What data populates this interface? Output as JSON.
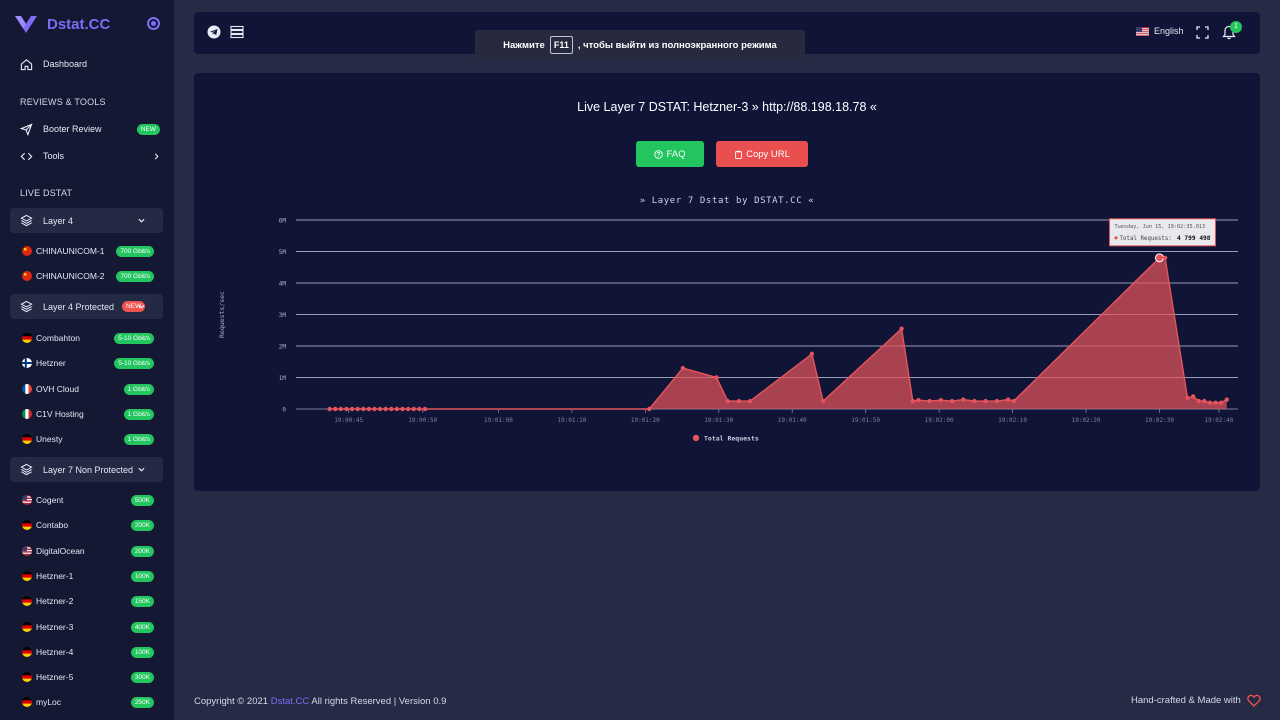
{
  "brand": {
    "name": "Dstat.CC"
  },
  "sidebar": {
    "dashboard": "Dashboard",
    "section_reviews": "REVIEWS & TOOLS",
    "booter_review": "Booter Review",
    "booter_badge": "NEW",
    "tools": "Tools",
    "section_live": "LIVE DSTAT",
    "layer4": {
      "label": "Layer 4",
      "items": [
        {
          "name": "CHINAUNICOM-1",
          "badge": "700 Gbit/s",
          "flag": "cn"
        },
        {
          "name": "CHINAUNICOM-2",
          "badge": "700 Gbit/s",
          "flag": "cn"
        }
      ]
    },
    "layer4p": {
      "label": "Layer 4 Protected",
      "badge": "NEW",
      "items": [
        {
          "name": "Combahton",
          "badge": "5-10 Gbit/s",
          "flag": "de"
        },
        {
          "name": "Hetzner",
          "badge": "5-10 Gbit/s",
          "flag": "fi"
        },
        {
          "name": "OVH Cloud",
          "badge": "1 Gbit/s",
          "flag": "fr"
        },
        {
          "name": "C1V Hosting",
          "badge": "1 Gbit/s",
          "flag": "it"
        },
        {
          "name": "Unesty",
          "badge": "1 Gbit/s",
          "flag": "de"
        }
      ]
    },
    "layer7": {
      "label": "Layer 7 Non Protected",
      "items": [
        {
          "name": "Cogent",
          "badge": "500K",
          "flag": "us"
        },
        {
          "name": "Contabo",
          "badge": "200K",
          "flag": "de"
        },
        {
          "name": "DigitalOcean",
          "badge": "200K",
          "flag": "us"
        },
        {
          "name": "Hetzner-1",
          "badge": "100K",
          "flag": "de"
        },
        {
          "name": "Hetzner-2",
          "badge": "150K",
          "flag": "de"
        },
        {
          "name": "Hetzner-3",
          "badge": "400K",
          "flag": "de"
        },
        {
          "name": "Hetzner-4",
          "badge": "100K",
          "flag": "de"
        },
        {
          "name": "Hetzner-5",
          "badge": "300K",
          "flag": "de"
        },
        {
          "name": "myLoc",
          "badge": "250K",
          "flag": "de"
        }
      ]
    }
  },
  "topbar": {
    "language": "English",
    "notifications": "1",
    "fullscreen_notice_before": "Нажмите",
    "fullscreen_notice_key": "F11",
    "fullscreen_notice_after": ", чтобы выйти из полноэкранного режима"
  },
  "main": {
    "title": "Live Layer 7 DSTAT: Hetzner-3 » http://88.198.18.78 «",
    "faq_button": "FAQ",
    "copy_button": "Copy URL",
    "chart_title": "» Layer 7 Dstat by DSTAT.CC «"
  },
  "chart_data": {
    "type": "area",
    "title": "» Layer 7 Dstat by DSTAT.CC «",
    "ylabel": "Requests/sec",
    "ylim": [
      0,
      6000000
    ],
    "y_ticks": [
      "0",
      "1M",
      "2M",
      "3M",
      "4M",
      "5M",
      "6M"
    ],
    "x_ticks": [
      "19:00:45",
      "19:00:50",
      "19:01:00",
      "19:01:10",
      "19:01:20",
      "19:01:30",
      "19:01:40",
      "19:01:50",
      "19:02:00",
      "19:02:10",
      "19:02:20",
      "19:02:30",
      "19:02:40"
    ],
    "series": [
      {
        "name": "Total Requests",
        "color": "#e5545a",
        "x": [
          40.5,
          41,
          41.5,
          42,
          42.5,
          43,
          43.5,
          44,
          44.5,
          45,
          45.5,
          46,
          46.5,
          47,
          47.5,
          48,
          48.5,
          49,
          69,
          72,
          75,
          76,
          77,
          78,
          83.5,
          84.5,
          91.5,
          92.5,
          93,
          94,
          95,
          96,
          97,
          98,
          99,
          100,
          101,
          101.5,
          114.5,
          115,
          117,
          117.5,
          118,
          118.5,
          119,
          119.5,
          120,
          120.5
        ],
        "values": [
          0,
          0,
          0,
          0,
          0,
          0,
          0,
          0,
          0,
          0,
          0,
          0,
          0,
          0,
          0,
          0,
          0,
          0,
          0,
          1300000,
          1000000,
          250000,
          250000,
          250000,
          1750000,
          250000,
          2550000,
          250000,
          280000,
          250000,
          280000,
          250000,
          300000,
          250000,
          250000,
          250000,
          300000,
          250000,
          4799498,
          4799498,
          350000,
          400000,
          250000,
          250000,
          200000,
          200000,
          200000,
          300000
        ]
      }
    ],
    "tooltip": {
      "date": "Tuesday, Jun 15, 19:02:35.013",
      "label": "Total Requests:",
      "value": "4 799 498"
    },
    "legend": "bottom",
    "grid": true
  },
  "footer": {
    "copyright_prefix": "Copyright © 2021",
    "copyright_link": "Dstat.CC",
    "copyright_suffix": "All rights Reserved | Version 0.9",
    "made_with": "Hand-crafted & Made with"
  }
}
